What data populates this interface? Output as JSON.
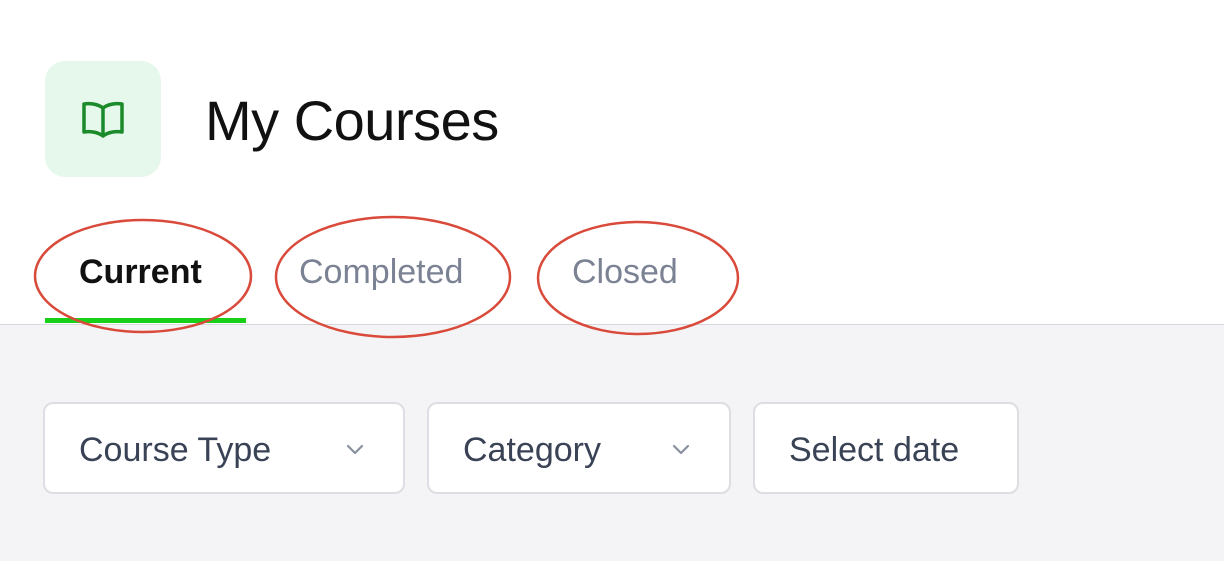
{
  "header": {
    "icon": "open-book-icon",
    "title": "My Courses"
  },
  "tabs": [
    {
      "label": "Current",
      "active": true
    },
    {
      "label": "Completed",
      "active": false
    },
    {
      "label": "Closed",
      "active": false
    }
  ],
  "filters": {
    "course_type": {
      "label": "Course Type",
      "icon": "chevron-down-icon"
    },
    "category": {
      "label": "Category",
      "icon": "chevron-down-icon"
    },
    "date": {
      "label": "Select date"
    }
  },
  "colors": {
    "accent_green": "#17d017",
    "icon_green": "#1a8a2a",
    "icon_tile_bg": "#e6f7ec",
    "annotation_red": "#d94a3a",
    "filter_area_bg": "#f4f4f6"
  }
}
